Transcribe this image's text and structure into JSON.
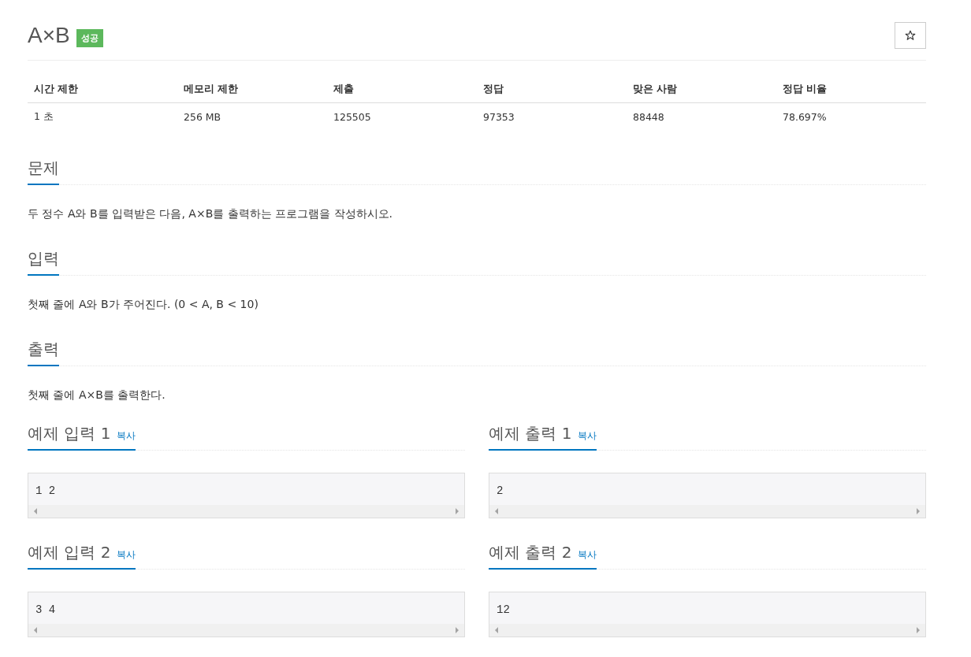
{
  "title": "A×B",
  "badge": {
    "label": "성공",
    "kind": "success"
  },
  "favorite": {
    "selected": false
  },
  "info_table": {
    "columns": [
      "시간 제한",
      "메모리 제한",
      "제출",
      "정답",
      "맞은 사람",
      "정답 비율"
    ],
    "rows": [
      [
        "1 초",
        "256 MB",
        "125505",
        "97353",
        "88448",
        "78.697%"
      ]
    ]
  },
  "sections": [
    {
      "heading": "문제",
      "text": "두 정수 A와 B를 입력받은 다음, A×B를 출력하는 프로그램을 작성하시오."
    },
    {
      "heading": "입력",
      "text": "첫째 줄에 A와 B가 주어진다. (0 < A, B < 10)"
    },
    {
      "heading": "출력",
      "text": "첫째 줄에 A×B를 출력한다."
    }
  ],
  "samples": [
    {
      "heading": "예제 입력 1",
      "copy": "복사",
      "code": "1 2"
    },
    {
      "heading": "예제 출력 1",
      "copy": "복사",
      "code": "2"
    },
    {
      "heading": "예제 입력 2",
      "copy": "복사",
      "code": "3 4"
    },
    {
      "heading": "예제 출력 2",
      "copy": "복사",
      "code": "12"
    }
  ]
}
